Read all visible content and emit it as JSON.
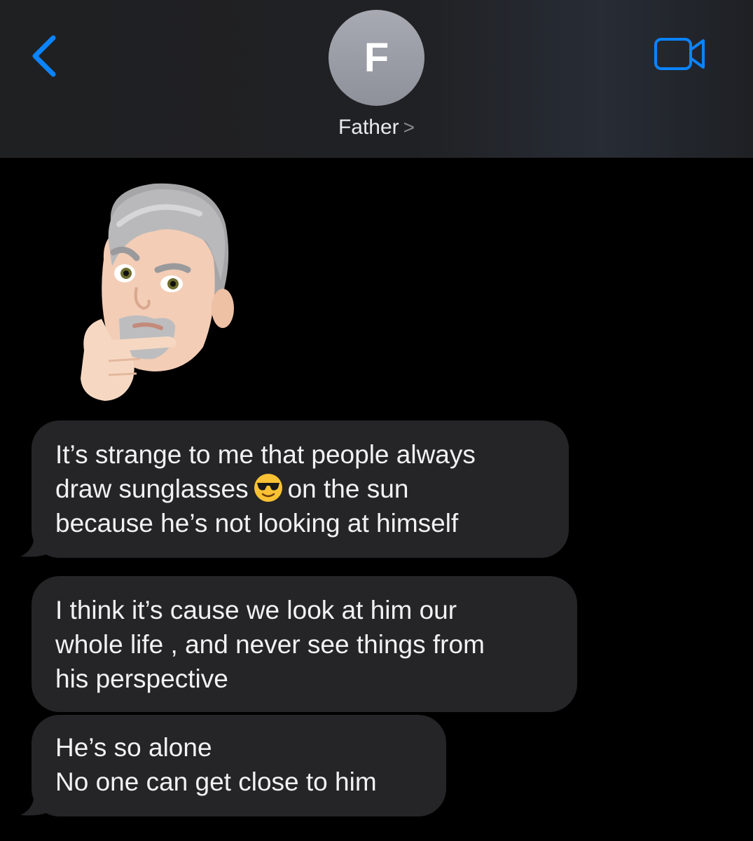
{
  "header": {
    "avatar_initial": "F",
    "contact_name": "Father",
    "chevron": ">",
    "back_icon": "chevron-left-icon",
    "video_icon": "video-camera-icon",
    "accent_color": "#0a84ff"
  },
  "sticker": {
    "icon": "thinking-memoji-sticker"
  },
  "messages": [
    {
      "lines": [
        "It’s strange to me that people always",
        "draw sunglasses",
        "on the sun",
        "because he’s not looking at himself"
      ],
      "emoji": "smiling-face-with-sunglasses"
    },
    {
      "lines": [
        "I think it’s cause we look at him our",
        "whole life , and never see things from",
        "his perspective"
      ]
    },
    {
      "lines": [
        "He’s so alone",
        "No one can get close to him"
      ]
    }
  ]
}
